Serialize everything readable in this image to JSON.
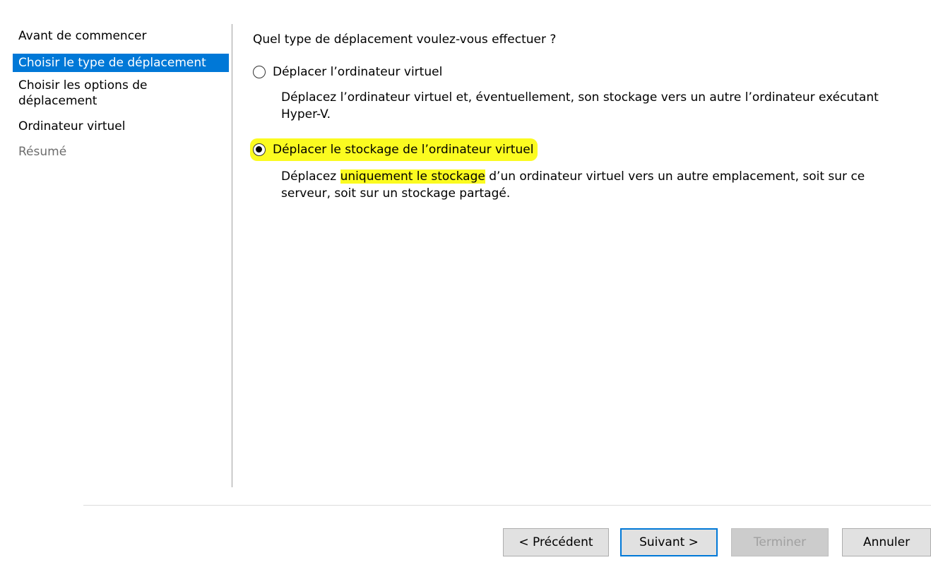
{
  "sidebar": {
    "items": [
      {
        "label": "Avant de commencer"
      },
      {
        "label": "Choisir le type de déplacement"
      },
      {
        "label": "Choisir les options de déplacement"
      },
      {
        "label": "Ordinateur virtuel"
      },
      {
        "label": "Résumé"
      }
    ]
  },
  "main": {
    "question": "Quel type de déplacement voulez-vous effectuer ?",
    "options": [
      {
        "label": "Déplacer l’ordinateur virtuel",
        "description": "Déplacez l’ordinateur virtuel et, éventuellement, son stockage vers un autre l’ordinateur exécutant Hyper-V.",
        "checked": false
      },
      {
        "label": "Déplacer le stockage de l’ordinateur virtuel",
        "description_before": "Déplacez ",
        "description_highlight": "uniquement le stockage",
        "description_after": " d’un ordinateur virtuel vers un autre emplacement, soit sur ce serveur, soit sur un stockage partagé.",
        "checked": true
      }
    ]
  },
  "footer": {
    "previous_label": "< Précédent",
    "next_label": "Suivant >",
    "finish_label": "Terminer",
    "cancel_label": "Annuler"
  },
  "colors": {
    "selection": "#0078d7",
    "highlight": "#fbfb20"
  }
}
